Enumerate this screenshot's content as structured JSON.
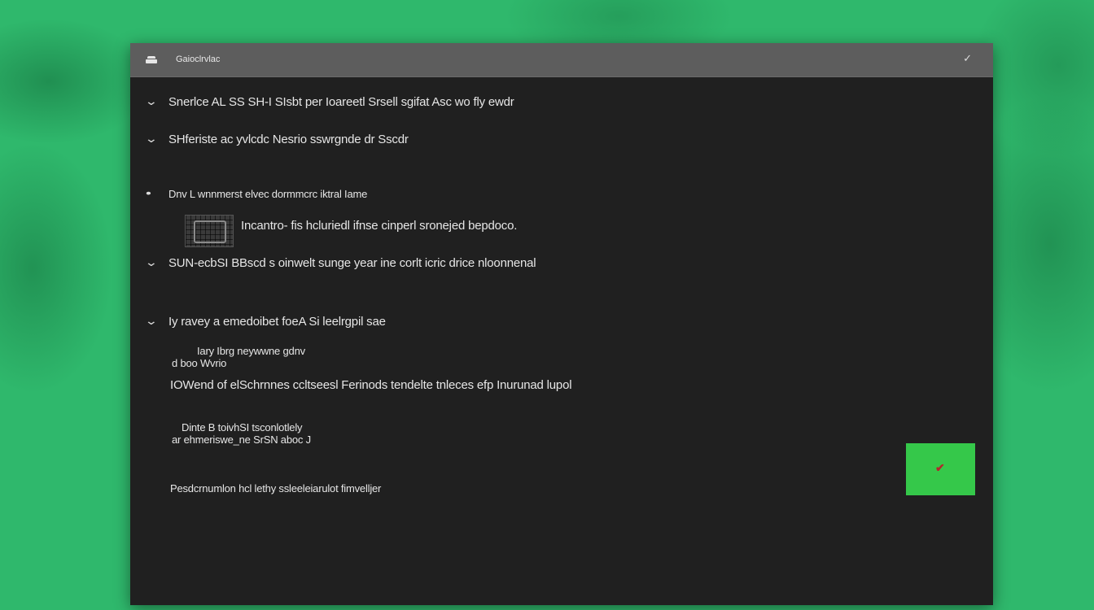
{
  "window": {
    "title": "Gaioclrvlac",
    "close_glyph": "✓"
  },
  "content": {
    "item1": "Snerlce AL SS SH-I SIsbt per Ioareetl Srsell sgifat Asc wo fly ewdr",
    "item2": "SHferiste ac yvlcdc Nesrio sswrgnde dr Sscdr",
    "item3_heading": "Dnv L wnnmerst elvec dormmcrc iktral Iame",
    "item3_thumb_text": "Incantro- fis hcluriedl ifnse cinperl sronejed bepdoco.",
    "item4": "SUN-ecbSI BBscd s oinwelt sunge year ine corlt icric drice nloonnenal",
    "item5": "Iy ravey a emedoibet foeA Si leelrgpil sae",
    "note1_line1": "Iary Ibrg neywwne gdnv",
    "note1_line2": "d boo Wvrio",
    "note2": "IOWend of elSchrnnes ccltseesl Ferinods tendelte tnleces efp Inurunad lupol",
    "sub_line1": "Dinte B toivhSI tsconlotlely",
    "sub_line2": "ar ehmeriswe_ne SrSN aboc J",
    "footer": "Pesdcrnumlon hcl lethy ssleeleiarulot fimvelljer"
  },
  "action": {
    "confirm_glyph": "✔",
    "confirm_color": "#35c84a",
    "check_color": "#b3262b"
  },
  "icons": {
    "chevron": "⌄",
    "bullet": "•"
  }
}
